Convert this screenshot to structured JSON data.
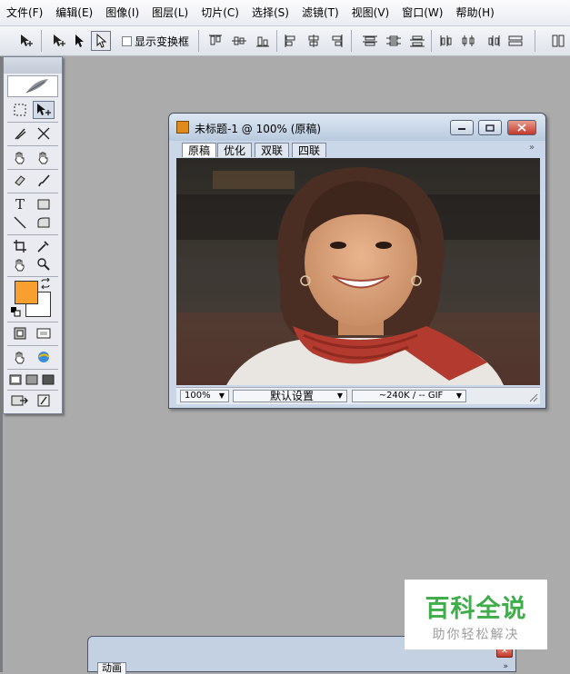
{
  "menu": [
    "文件(F)",
    "编辑(E)",
    "图像(I)",
    "图层(L)",
    "切片(C)",
    "选择(S)",
    "滤镜(T)",
    "视图(V)",
    "窗口(W)",
    "帮助(H)"
  ],
  "options_bar": {
    "show_transform_label": "显示变换框"
  },
  "document": {
    "title": "未标题-1 @ 100% (原稿)",
    "tabs": [
      "原稿",
      "优化",
      "双联",
      "四联"
    ],
    "active_tab": "原稿",
    "status": {
      "zoom": "100%",
      "preset": "默认设置",
      "size_info": "~240K / -- GIF"
    }
  },
  "bottom_panel": {
    "tab": "动画"
  },
  "watermark": {
    "title": "百科全说",
    "subtitle": "助你轻松解决"
  },
  "colors": {
    "foreground": "#f7a030",
    "background": "#ffffff",
    "workspace": "#ababab",
    "watermark_green": "#3fae4a"
  }
}
